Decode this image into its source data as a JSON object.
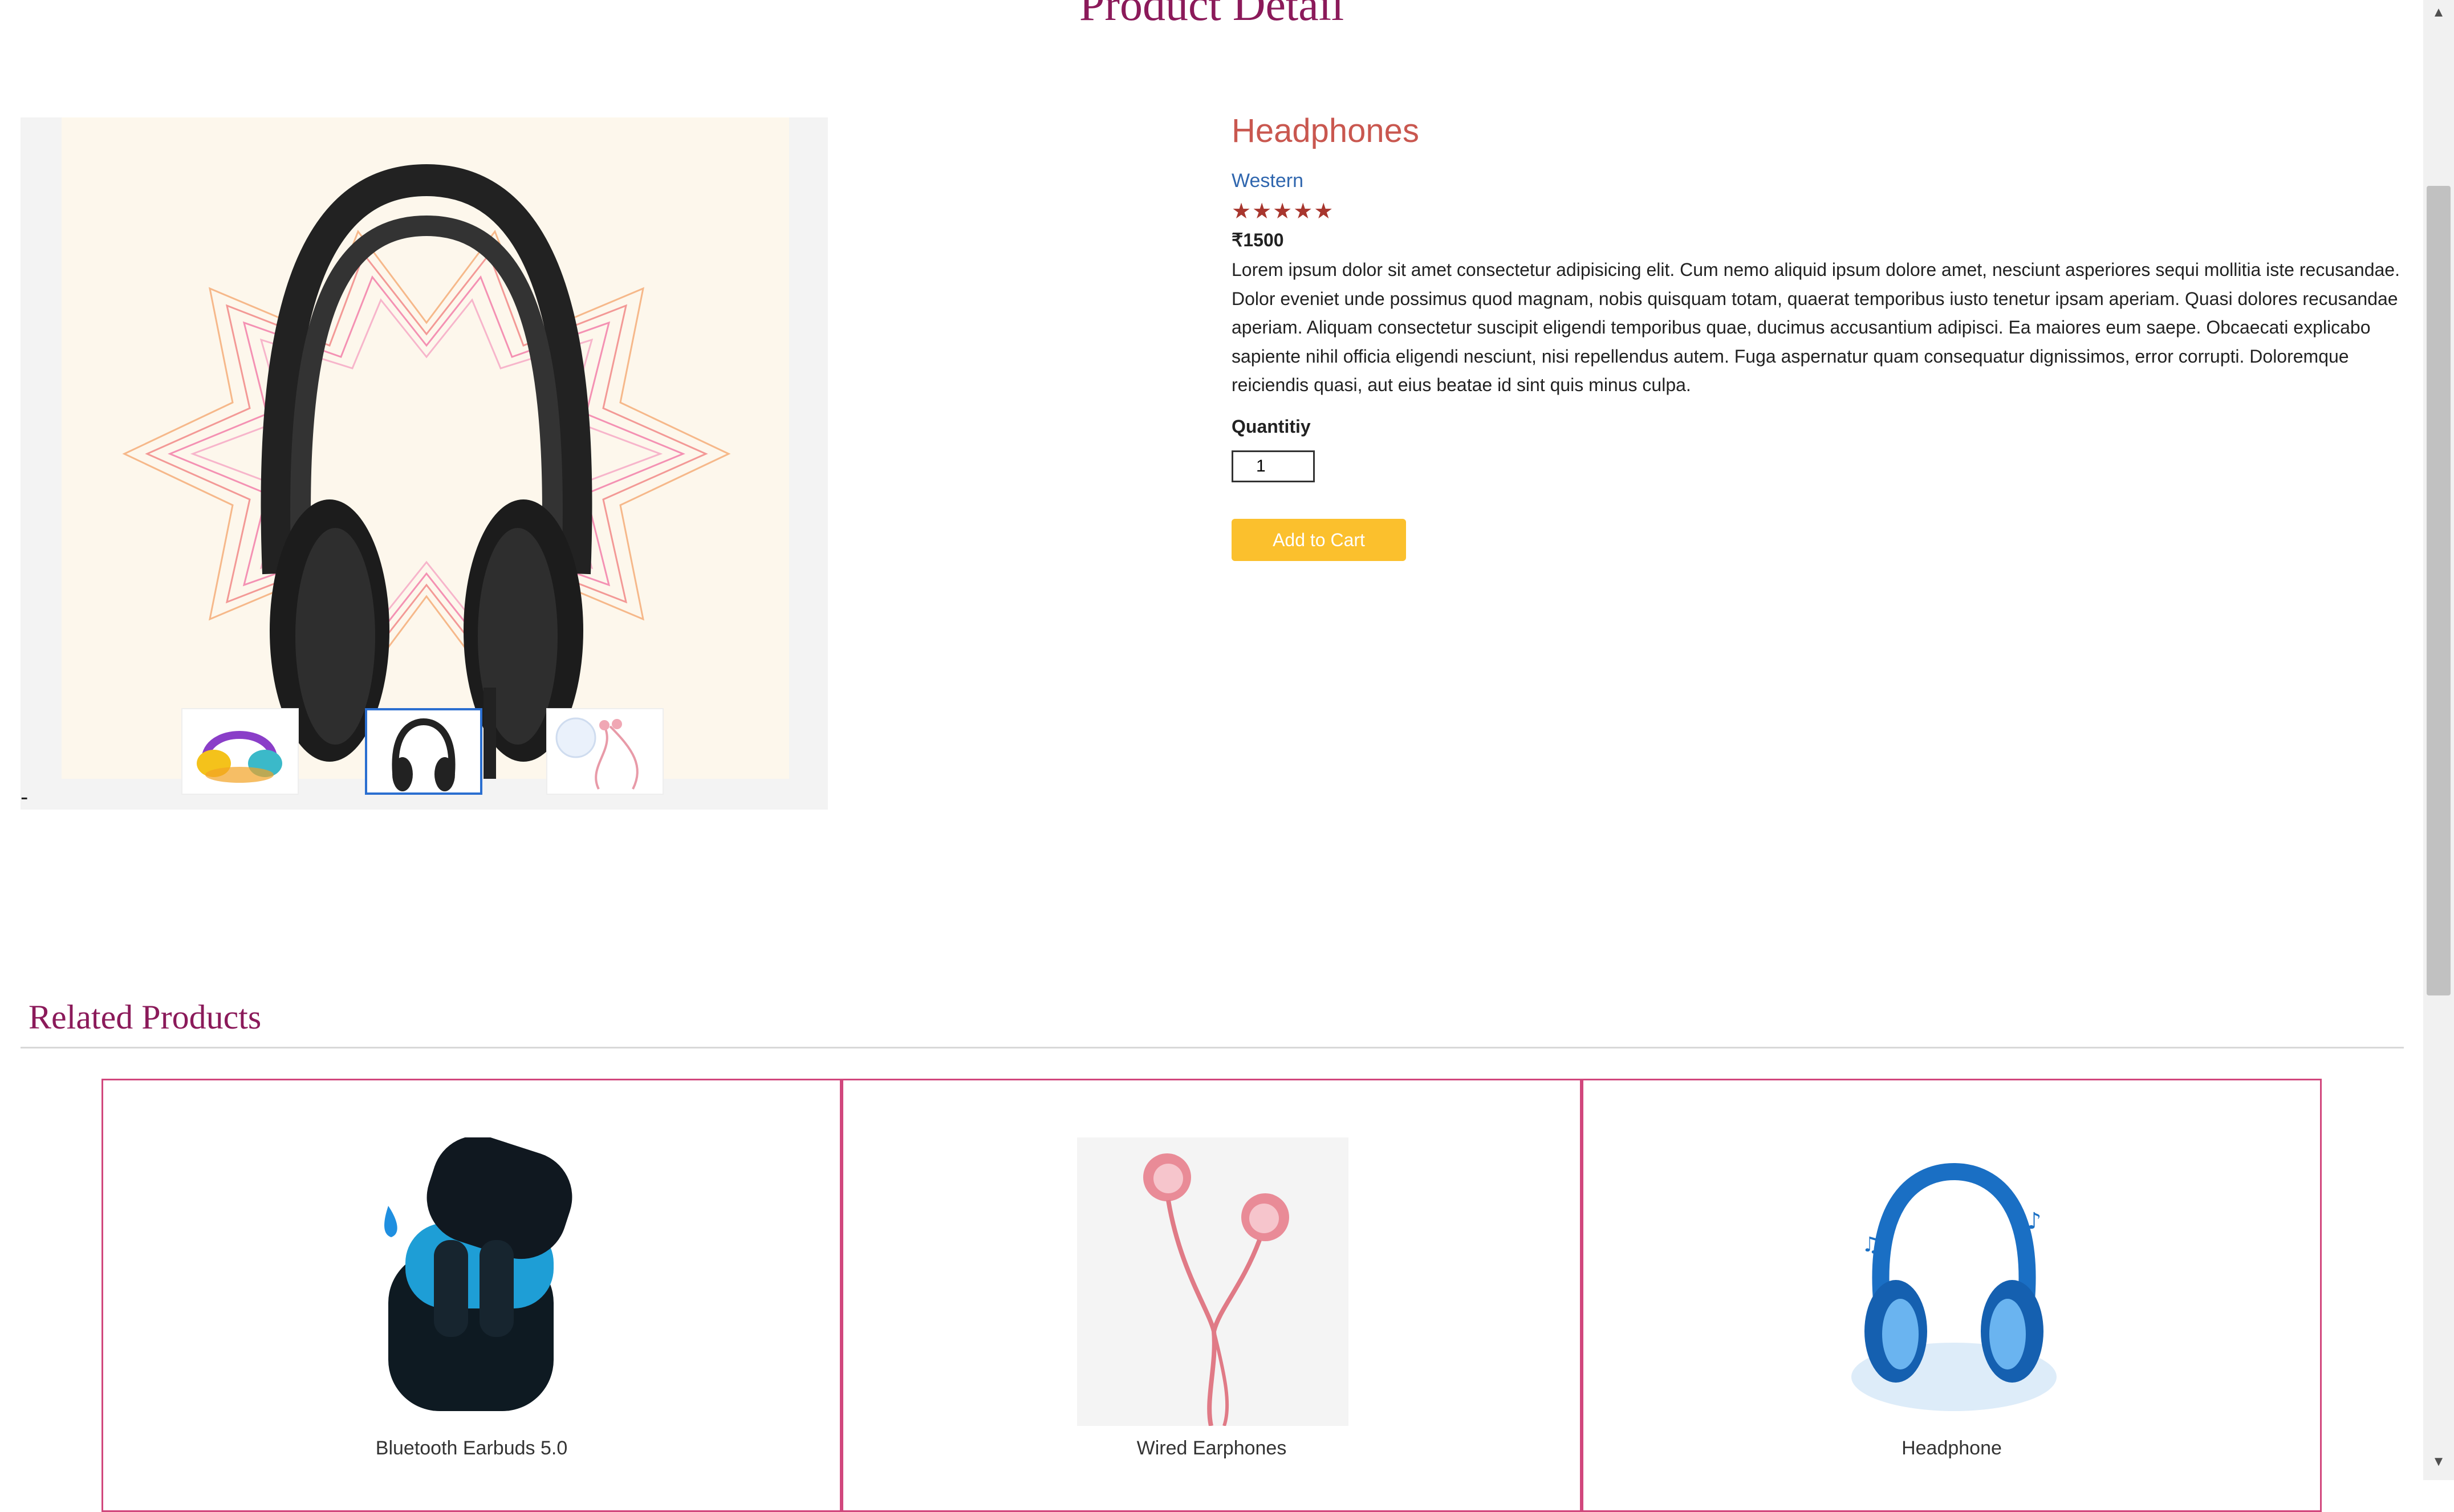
{
  "page": {
    "title": "Product Detail"
  },
  "gallery": {
    "main_image": "headphones-black-sound-waves",
    "thumbnails": [
      {
        "image": "colorful-headphones"
      },
      {
        "image": "black-headphones",
        "active": true
      },
      {
        "image": "pink-wired-earphones"
      }
    ],
    "stray_mark": "-"
  },
  "product": {
    "name": "Headphones",
    "category": "Western",
    "rating": 5,
    "stars": "★★★★★",
    "price": "₹1500",
    "description": "Lorem ipsum dolor sit amet consectetur adipisicing elit. Cum nemo aliquid ipsum dolore amet, nesciunt asperiores sequi mollitia iste recusandae. Dolor eveniet unde possimus quod magnam, nobis quisquam totam, quaerat temporibus iusto tenetur ipsam aperiam. Quasi dolores recusandae aperiam. Aliquam consectetur suscipit eligendi temporibus quae, ducimus accusantium adipisci. Ea maiores eum saepe. Obcaecati explicabo sapiente nihil officia eligendi nesciunt, nisi repellendus autem. Fuga aspernatur quam consequatur dignissimos, error corrupti. Doloremque reiciendis quasi, aut eius beatae id sint quis minus culpa.",
    "quantity_label": "Quantitiy",
    "quantity_value": "1",
    "add_to_cart_label": "Add to Cart"
  },
  "related": {
    "heading": "Related Products",
    "items": [
      {
        "name": "Bluetooth Earbuds 5.0",
        "image": "earbuds-case-icon"
      },
      {
        "name": "Wired Earphones",
        "image": "wired-earphones-icon"
      },
      {
        "name": "Headphone",
        "image": "blue-headphone-icon"
      }
    ]
  },
  "colors": {
    "title": "#8b1a5a",
    "product_name": "#c9574f",
    "category": "#2f66ae",
    "stars": "#a8362e",
    "button": "#fbc02d",
    "card_border": "#d1477d"
  }
}
